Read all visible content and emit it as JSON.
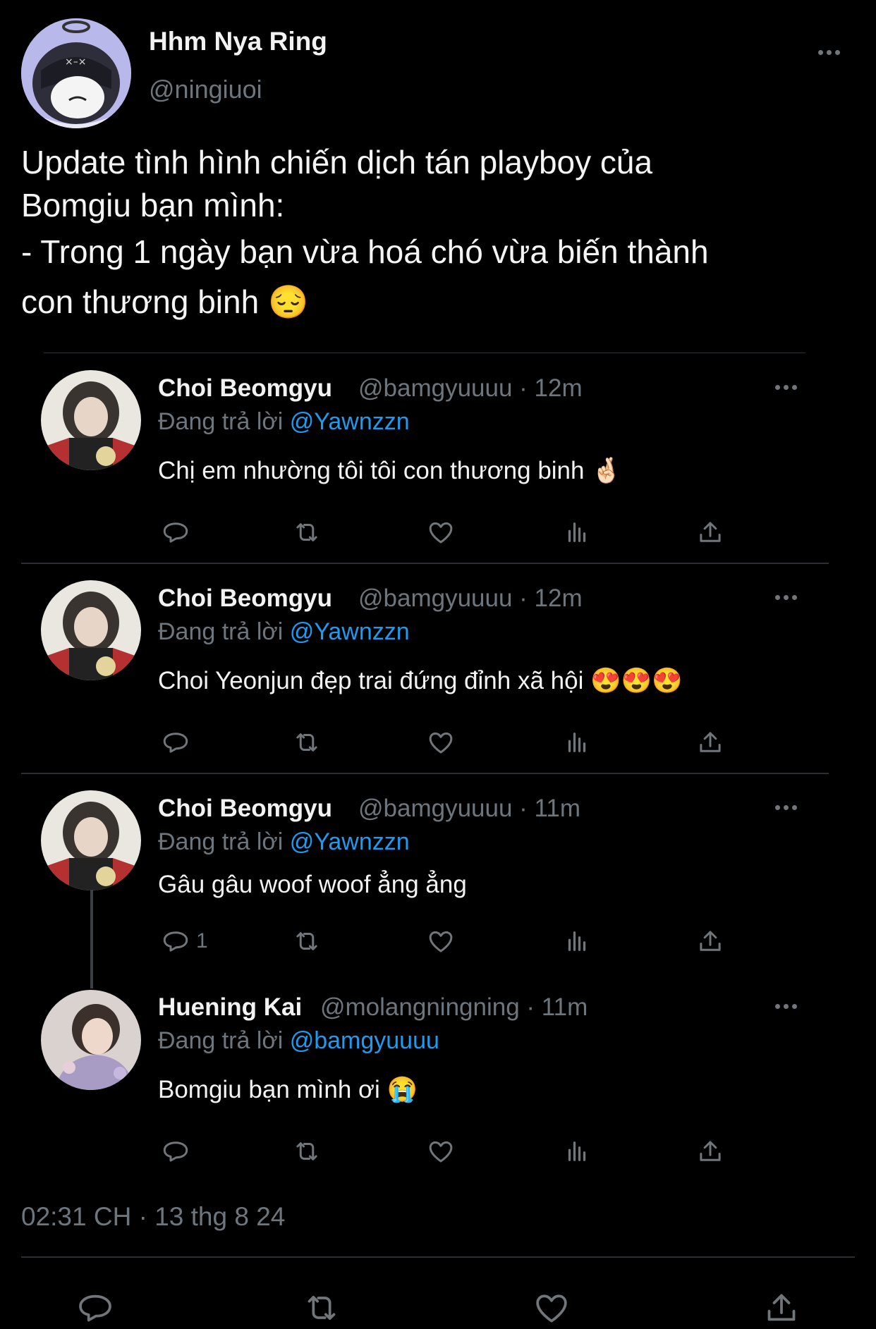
{
  "author": {
    "name": "Hhm Nya Ring",
    "handle": "@ningiuoi"
  },
  "tweet": {
    "lines": [
      "Update tình hình chiến dịch tán playboy của",
      "Bomgiu bạn mình:",
      "- Trong 1 ngày bạn vừa hoá chó vừa biến thành",
      "con thương binh 😔"
    ]
  },
  "replies": [
    {
      "name": "Choi Beomgyu",
      "handle_time": "@bamgyuuuu · 12m",
      "replying_prefix": "Đang trả lời ",
      "replying_to": "@Yawnzzn",
      "text": "Chị em nhường tôi tôi con thương binh 🤞🏻",
      "reply_count": ""
    },
    {
      "name": "Choi Beomgyu",
      "handle_time": "@bamgyuuuu · 12m",
      "replying_prefix": "Đang trả lời ",
      "replying_to": "@Yawnzzn",
      "text": "Choi Yeonjun đẹp trai đứng đỉnh xã hội 😍😍😍",
      "reply_count": ""
    },
    {
      "name": "Choi Beomgyu",
      "handle_time": "@bamgyuuuu · 11m",
      "replying_prefix": "Đang trả lời ",
      "replying_to": "@Yawnzzn",
      "text": "Gâu gâu woof woof ẳng ẳng",
      "reply_count": "1"
    },
    {
      "name": "Huening Kai",
      "handle_time": "@molangningning · 11m",
      "replying_prefix": "Đang trả lời ",
      "replying_to": "@bamgyuuuu",
      "text": "Bomgiu bạn mình ơi 😭",
      "reply_count": ""
    }
  ],
  "timestamp": "02:31 CH · 13 thg 8 24",
  "icons": {
    "reply": "reply-icon",
    "retweet": "retweet-icon",
    "like": "heart-icon",
    "views": "views-icon",
    "share": "share-icon",
    "more": "more-icon"
  },
  "colors": {
    "background": "#000000",
    "mention": "#1d9bf0",
    "muted": "#6e767d",
    "avatar_bg": "#b9b8ea"
  }
}
